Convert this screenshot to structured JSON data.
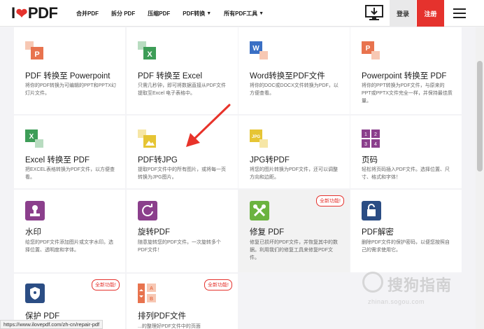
{
  "header": {
    "logo_left": "I",
    "logo_right": "PDF",
    "nav": [
      {
        "label": "合并PDF",
        "caret": false
      },
      {
        "label": "拆分 PDF",
        "caret": false
      },
      {
        "label": "压缩PDF",
        "caret": false
      },
      {
        "label": "PDF转换",
        "caret": true
      },
      {
        "label": "所有PDF工具",
        "caret": true
      }
    ],
    "login_label": "登录",
    "signup_label": "注册"
  },
  "badge_label": "全新功能!",
  "tools": [
    {
      "title": "PDF 转换至 Powerpoint",
      "desc": "将你的PDF转换为可编辑的PPT和PPTX幻灯片文件。",
      "icon": "pdf-to-powerpoint-icon",
      "color": "#e8734e",
      "letter": "P"
    },
    {
      "title": "PDF 转换至 Excel",
      "desc": "只需几秒钟，即可将数据直接从PDF文件提取至Excel 电子表格中。",
      "icon": "pdf-to-excel-icon",
      "color": "#3d9d57",
      "letter": "X"
    },
    {
      "title": "Word转换至PDF文件",
      "desc": "将你的DOC或DOCX文件转换为PDF，以方便查看。",
      "icon": "word-to-pdf-icon",
      "color": "#3a6fc4",
      "letter": "W"
    },
    {
      "title": "Powerpoint 转换至 PDF",
      "desc": "将你的PPT转换为PDF文件，与原来的PPT或PPTX文件完全一样，并保持最佳质量。",
      "icon": "powerpoint-to-pdf-icon",
      "color": "#e8734e",
      "letter": "P"
    },
    {
      "title": "Excel 转换至 PDF",
      "desc": "把EXCEL表格转换为PDF文件，以方便查看。",
      "icon": "excel-to-pdf-icon",
      "color": "#3d9d57",
      "letter": "X"
    },
    {
      "title": "PDF转JPG",
      "desc": "提取PDF文件中的所有图片，或将每一页转换为JPG图片。",
      "icon": "pdf-to-jpg-icon",
      "color": "#e6c534",
      "letter": ""
    },
    {
      "title": "JPG转PDF",
      "desc": "将您的图片转换为PDF文件，还可以调整方向和边距。",
      "icon": "jpg-to-pdf-icon",
      "color": "#e6c534",
      "letter": "JPG"
    },
    {
      "title": "页码",
      "desc": "轻松将页码插入PDF文件。选择位置、尺寸、格式和字体！",
      "icon": "page-numbers-icon",
      "color": "#8b3f8c",
      "letter": ""
    },
    {
      "title": "水印",
      "desc": "给您的PDF文件添加图片或文字水印。选择位置、透明度和字体。",
      "icon": "watermark-icon",
      "color": "#8b3f8c",
      "letter": ""
    },
    {
      "title": "旋转PDF",
      "desc": "随意旋转您的PDF文件。一次旋转多个PDF文件！",
      "icon": "rotate-pdf-icon",
      "color": "#8b3f8c",
      "letter": ""
    },
    {
      "title": "修复 PDF",
      "desc": "修复已损坏的PDF文件，并恢复其中的数据。利用我们的修复工具来修复PDF文件。",
      "icon": "repair-pdf-icon",
      "color": "#6bb33f",
      "letter": ""
    },
    {
      "title": "PDF解密",
      "desc": "删除PDF文件的保护密码，以便您按照自己的需求使用它。",
      "icon": "unlock-pdf-icon",
      "color": "#2b4d84",
      "letter": ""
    },
    {
      "title": "保护 PDF",
      "desc": "",
      "icon": "protect-pdf-icon",
      "color": "#2b4d84",
      "letter": ""
    },
    {
      "title": "排列PDF文件",
      "desc": "...的整理好PDF文件中的页面",
      "icon": "organize-pdf-icon",
      "color": "#e8734e",
      "letter": ""
    }
  ],
  "status_url": "https://www.ilovepdf.com/zh-cn/repair-pdf",
  "watermark": {
    "text": "搜狗指南",
    "url": "zhinan.sogou.com"
  }
}
